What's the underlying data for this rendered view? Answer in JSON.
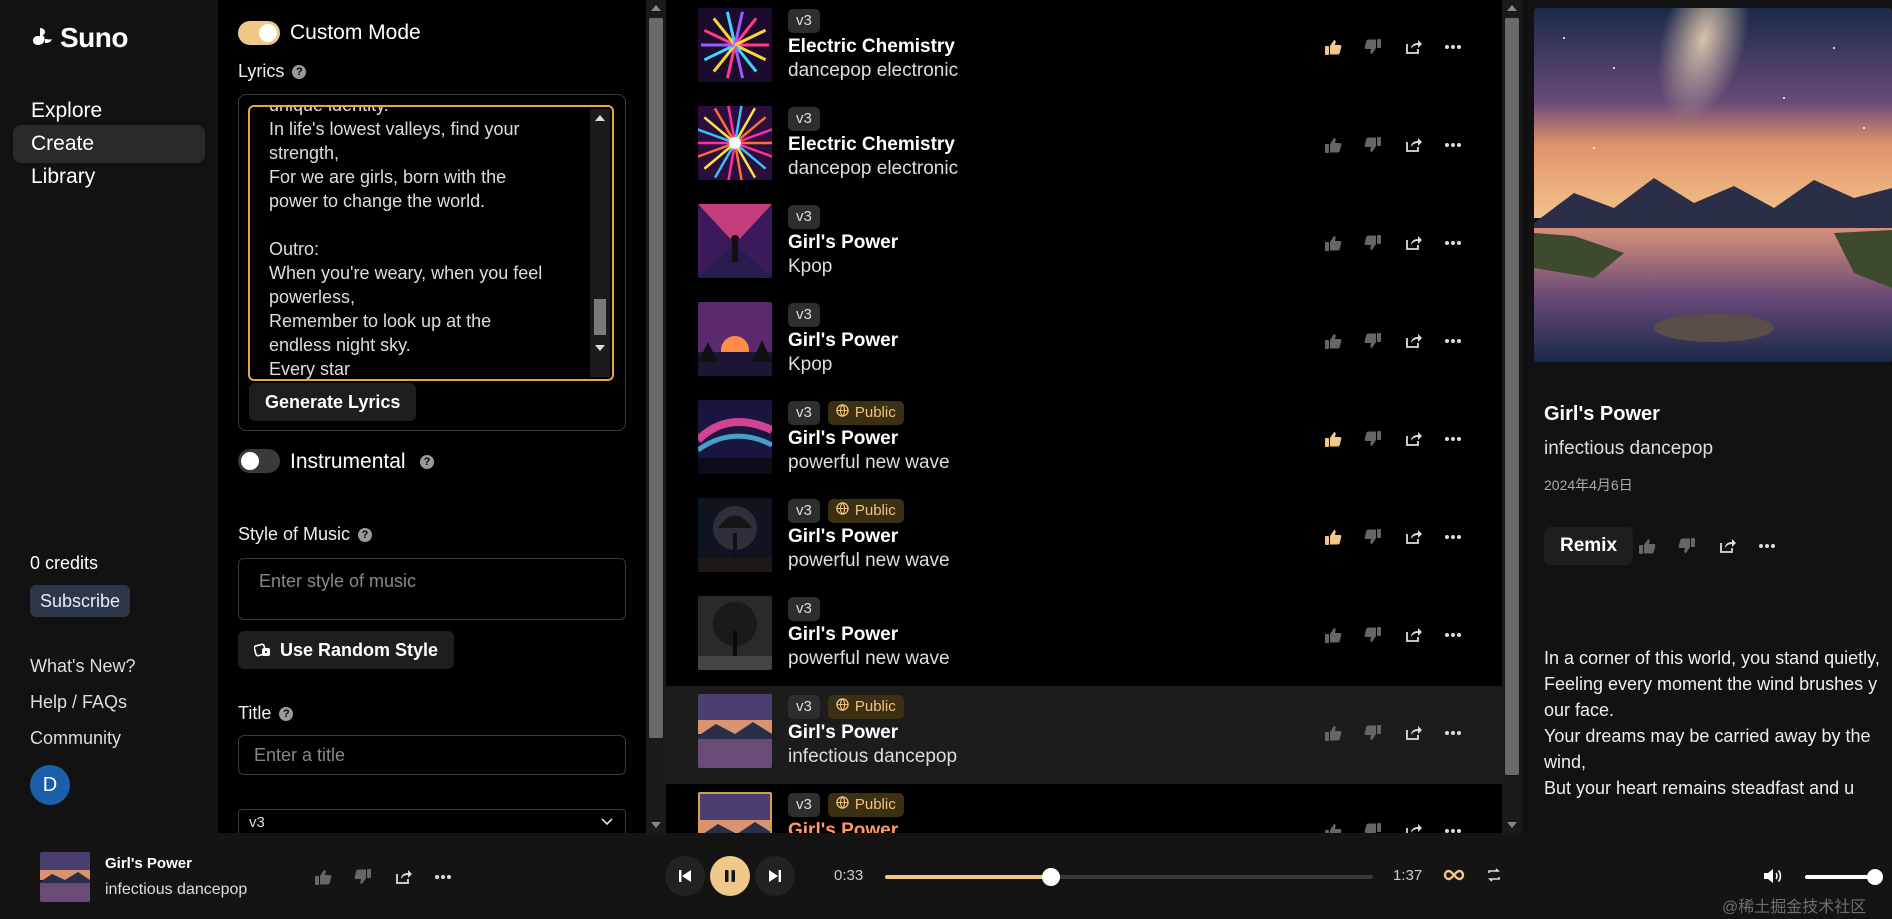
{
  "app": {
    "brand": "Suno"
  },
  "nav": {
    "items": [
      {
        "label": "Explore",
        "active": false
      },
      {
        "label": "Create",
        "active": true
      },
      {
        "label": "Library",
        "active": false
      }
    ],
    "credits": "0 credits",
    "subscribe_label": "Subscribe",
    "links": [
      "What's New?",
      "Help / FAQs",
      "Community"
    ],
    "avatar_initial": "D"
  },
  "create": {
    "custom_mode_label": "Custom Mode",
    "custom_mode_on": true,
    "lyrics_label": "Lyrics",
    "lyrics_text": "unique identity.\nIn life's lowest valleys, find your\nstrength,\nFor we are girls, born with the\npower to change the world.\n\nOutro:\nWhen you're weary, when you feel\npowerless,\nRemember to look up at the\nendless night sky.\nEvery star",
    "generate_lyrics_label": "Generate Lyrics",
    "instrumental_label": "Instrumental",
    "instrumental_on": false,
    "style_label": "Style of Music",
    "style_placeholder": "Enter style of music",
    "random_style_label": "Use Random Style",
    "title_label": "Title",
    "title_placeholder": "Enter a title",
    "version_value": "v3"
  },
  "songs": [
    {
      "version": "v3",
      "public": false,
      "public_label": "",
      "title": "Electric Chemistry",
      "tags": "dancepop electronic",
      "liked": true,
      "selected": false,
      "playing": false,
      "art": "fireworks"
    },
    {
      "version": "v3",
      "public": false,
      "public_label": "",
      "title": "Electric Chemistry",
      "tags": "dancepop electronic",
      "liked": false,
      "selected": false,
      "playing": false,
      "art": "burst"
    },
    {
      "version": "v3",
      "public": false,
      "public_label": "",
      "title": "Girl's Power",
      "tags": "Kpop",
      "liked": false,
      "selected": false,
      "playing": false,
      "art": "girl"
    },
    {
      "version": "v3",
      "public": false,
      "public_label": "",
      "title": "Girl's Power",
      "tags": "Kpop",
      "liked": false,
      "selected": false,
      "playing": false,
      "art": "sunset"
    },
    {
      "version": "v3",
      "public": true,
      "public_label": "Public",
      "title": "Girl's Power",
      "tags": "powerful new wave",
      "liked": true,
      "selected": false,
      "playing": false,
      "art": "aurora"
    },
    {
      "version": "v3",
      "public": true,
      "public_label": "Public",
      "title": "Girl's Power",
      "tags": "powerful new wave",
      "liked": true,
      "selected": false,
      "playing": false,
      "art": "tree"
    },
    {
      "version": "v3",
      "public": false,
      "public_label": "",
      "title": "Girl's Power",
      "tags": "powerful new wave",
      "liked": false,
      "selected": false,
      "playing": false,
      "art": "treegray"
    },
    {
      "version": "v3",
      "public": true,
      "public_label": "Public",
      "title": "Girl's Power",
      "tags": "infectious dancepop",
      "liked": false,
      "selected": true,
      "playing": false,
      "art": "lake"
    },
    {
      "version": "v3",
      "public": true,
      "public_label": "Public",
      "title": "Girl's Power",
      "tags": "",
      "liked": false,
      "selected": false,
      "playing": true,
      "art": "lake"
    }
  ],
  "detail": {
    "title": "Girl's Power",
    "tags": "infectious dancepop",
    "date": "2024年4月6日",
    "remix_label": "Remix",
    "lyrics": "In a corner of this world, you stand quietly,\nFeeling every moment the wind brushes your face.\nYour dreams may be carried away by the wind,\nBut your heart remains steadfast and u"
  },
  "player": {
    "title": "Girl's Power",
    "tags": "infectious dancepop",
    "current_time": "0:33",
    "total_time": "1:37",
    "progress": 0.34,
    "volume": 1.0
  },
  "watermark": "@稀土掘金技术社区",
  "colors": {
    "accent": "#f0c889",
    "playing_title": "#ff9966",
    "public_badge_text": "#f1c27d"
  }
}
